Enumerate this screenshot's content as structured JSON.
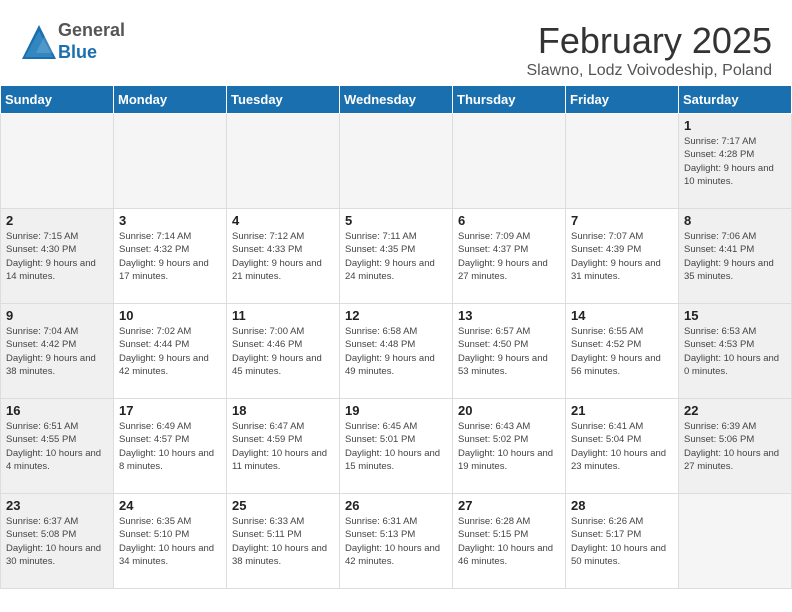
{
  "header": {
    "logo_general": "General",
    "logo_blue": "Blue",
    "month_title": "February 2025",
    "subtitle": "Slawno, Lodz Voivodeship, Poland"
  },
  "columns": [
    "Sunday",
    "Monday",
    "Tuesday",
    "Wednesday",
    "Thursday",
    "Friday",
    "Saturday"
  ],
  "weeks": [
    {
      "days": [
        {
          "num": "",
          "info": "",
          "empty": true
        },
        {
          "num": "",
          "info": "",
          "empty": true
        },
        {
          "num": "",
          "info": "",
          "empty": true
        },
        {
          "num": "",
          "info": "",
          "empty": true
        },
        {
          "num": "",
          "info": "",
          "empty": true
        },
        {
          "num": "",
          "info": "",
          "empty": true
        },
        {
          "num": "1",
          "info": "Sunrise: 7:17 AM\nSunset: 4:28 PM\nDaylight: 9 hours and 10 minutes."
        }
      ]
    },
    {
      "days": [
        {
          "num": "2",
          "info": "Sunrise: 7:15 AM\nSunset: 4:30 PM\nDaylight: 9 hours and 14 minutes."
        },
        {
          "num": "3",
          "info": "Sunrise: 7:14 AM\nSunset: 4:32 PM\nDaylight: 9 hours and 17 minutes."
        },
        {
          "num": "4",
          "info": "Sunrise: 7:12 AM\nSunset: 4:33 PM\nDaylight: 9 hours and 21 minutes."
        },
        {
          "num": "5",
          "info": "Sunrise: 7:11 AM\nSunset: 4:35 PM\nDaylight: 9 hours and 24 minutes."
        },
        {
          "num": "6",
          "info": "Sunrise: 7:09 AM\nSunset: 4:37 PM\nDaylight: 9 hours and 27 minutes."
        },
        {
          "num": "7",
          "info": "Sunrise: 7:07 AM\nSunset: 4:39 PM\nDaylight: 9 hours and 31 minutes."
        },
        {
          "num": "8",
          "info": "Sunrise: 7:06 AM\nSunset: 4:41 PM\nDaylight: 9 hours and 35 minutes."
        }
      ]
    },
    {
      "days": [
        {
          "num": "9",
          "info": "Sunrise: 7:04 AM\nSunset: 4:42 PM\nDaylight: 9 hours and 38 minutes."
        },
        {
          "num": "10",
          "info": "Sunrise: 7:02 AM\nSunset: 4:44 PM\nDaylight: 9 hours and 42 minutes."
        },
        {
          "num": "11",
          "info": "Sunrise: 7:00 AM\nSunset: 4:46 PM\nDaylight: 9 hours and 45 minutes."
        },
        {
          "num": "12",
          "info": "Sunrise: 6:58 AM\nSunset: 4:48 PM\nDaylight: 9 hours and 49 minutes."
        },
        {
          "num": "13",
          "info": "Sunrise: 6:57 AM\nSunset: 4:50 PM\nDaylight: 9 hours and 53 minutes."
        },
        {
          "num": "14",
          "info": "Sunrise: 6:55 AM\nSunset: 4:52 PM\nDaylight: 9 hours and 56 minutes."
        },
        {
          "num": "15",
          "info": "Sunrise: 6:53 AM\nSunset: 4:53 PM\nDaylight: 10 hours and 0 minutes."
        }
      ]
    },
    {
      "days": [
        {
          "num": "16",
          "info": "Sunrise: 6:51 AM\nSunset: 4:55 PM\nDaylight: 10 hours and 4 minutes."
        },
        {
          "num": "17",
          "info": "Sunrise: 6:49 AM\nSunset: 4:57 PM\nDaylight: 10 hours and 8 minutes."
        },
        {
          "num": "18",
          "info": "Sunrise: 6:47 AM\nSunset: 4:59 PM\nDaylight: 10 hours and 11 minutes."
        },
        {
          "num": "19",
          "info": "Sunrise: 6:45 AM\nSunset: 5:01 PM\nDaylight: 10 hours and 15 minutes."
        },
        {
          "num": "20",
          "info": "Sunrise: 6:43 AM\nSunset: 5:02 PM\nDaylight: 10 hours and 19 minutes."
        },
        {
          "num": "21",
          "info": "Sunrise: 6:41 AM\nSunset: 5:04 PM\nDaylight: 10 hours and 23 minutes."
        },
        {
          "num": "22",
          "info": "Sunrise: 6:39 AM\nSunset: 5:06 PM\nDaylight: 10 hours and 27 minutes."
        }
      ]
    },
    {
      "days": [
        {
          "num": "23",
          "info": "Sunrise: 6:37 AM\nSunset: 5:08 PM\nDaylight: 10 hours and 30 minutes."
        },
        {
          "num": "24",
          "info": "Sunrise: 6:35 AM\nSunset: 5:10 PM\nDaylight: 10 hours and 34 minutes."
        },
        {
          "num": "25",
          "info": "Sunrise: 6:33 AM\nSunset: 5:11 PM\nDaylight: 10 hours and 38 minutes."
        },
        {
          "num": "26",
          "info": "Sunrise: 6:31 AM\nSunset: 5:13 PM\nDaylight: 10 hours and 42 minutes."
        },
        {
          "num": "27",
          "info": "Sunrise: 6:28 AM\nSunset: 5:15 PM\nDaylight: 10 hours and 46 minutes."
        },
        {
          "num": "28",
          "info": "Sunrise: 6:26 AM\nSunset: 5:17 PM\nDaylight: 10 hours and 50 minutes."
        },
        {
          "num": "",
          "info": "",
          "empty": true
        }
      ]
    }
  ]
}
